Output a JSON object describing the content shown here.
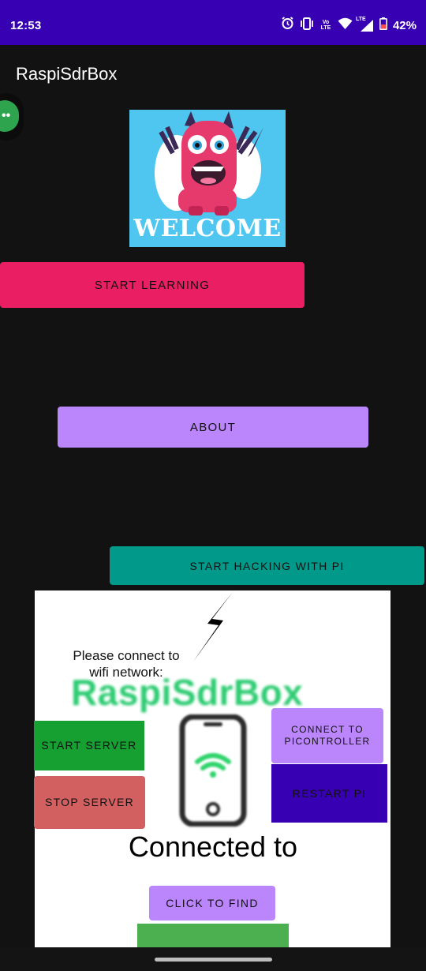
{
  "status_bar": {
    "time": "12:53",
    "volte_label": "Vo LTE",
    "lte_label": "LTE",
    "battery": "42%",
    "icons": [
      "alarm-icon",
      "vibrate-icon",
      "volte-icon",
      "wifi-icon",
      "signal-icon",
      "battery-icon"
    ]
  },
  "app_bar": {
    "title": "RaspiSdrBox"
  },
  "welcome_image": {
    "text": "WELCOME"
  },
  "buttons": {
    "start_learning": "START LEARNING",
    "about": "ABOUT",
    "start_hacking": "START HACKING WITH PI",
    "start_server": "START SERVER",
    "stop_server": "STOP SERVER",
    "connect_pi": "CONNECT TO PICONTROLLER",
    "restart_pi": "RESTART PI",
    "click_to_find": "CLICK TO FIND"
  },
  "panel": {
    "connect_prompt": "Please connect to wifi network:",
    "ssid": "RaspiSdrBox",
    "connected_label": "Connected to"
  },
  "colors": {
    "status_bar": "#3700b3",
    "background": "#121212",
    "pink": "#e91e63",
    "purple": "#bb86fc",
    "teal": "#01998a",
    "green": "#17a032",
    "red": "#d26061",
    "deep_purple": "#3700b3",
    "ssid_green": "#2dcc72"
  }
}
